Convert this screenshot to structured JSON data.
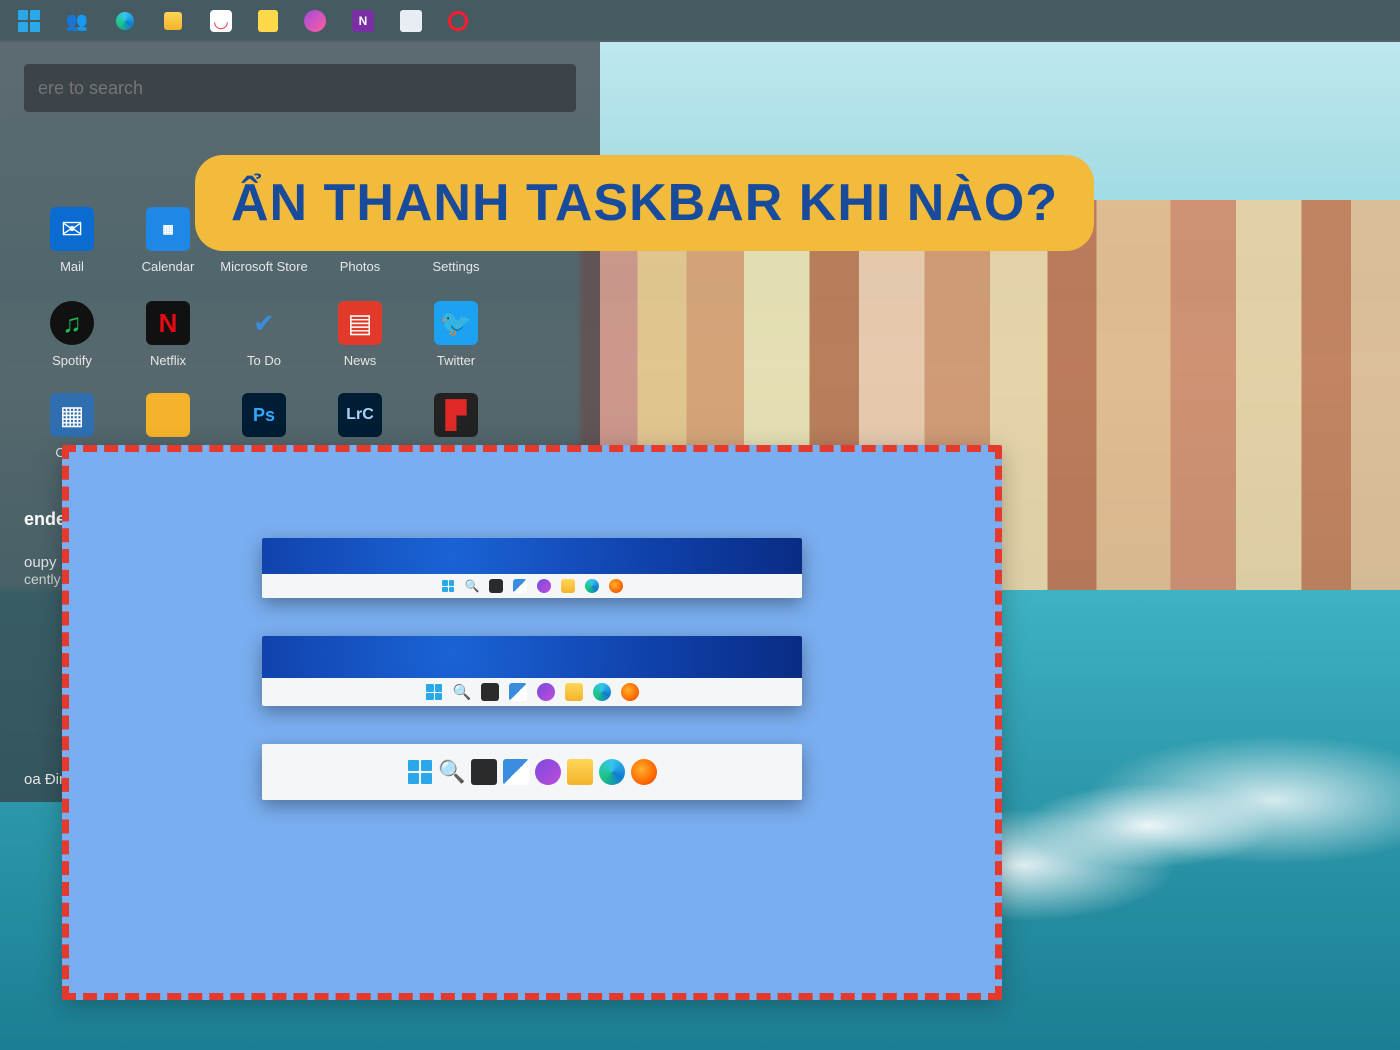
{
  "headline": "ẨN THANH TASKBAR KHI NÀO?",
  "search": {
    "placeholder": "ere to search"
  },
  "top_taskbar": {
    "icons": [
      "start",
      "people",
      "edge",
      "file-explorer",
      "pocket",
      "sticky-notes",
      "messenger",
      "onenote",
      "photos",
      "opera"
    ]
  },
  "tiles": {
    "row1": [
      {
        "label": "Mail",
        "icon": "mail",
        "bg": "#0a6bd1",
        "fg": "#fff"
      },
      {
        "label": "Calendar",
        "icon": "calendar",
        "bg": "#1f87e6",
        "fg": "#fff"
      },
      {
        "label": "Microsoft Store",
        "icon": "ms-store",
        "bg": "#ffffff",
        "fg": "#333"
      },
      {
        "label": "Photos",
        "icon": "photos",
        "bg": "#2f6fb0",
        "fg": "#fff"
      },
      {
        "label": "Settings",
        "icon": "settings",
        "bg": "transparent",
        "fg": "#e6e6e6"
      }
    ],
    "row2": [
      {
        "label": "Spotify",
        "icon": "spotify",
        "bg": "#111",
        "fg": "#1db954"
      },
      {
        "label": "Netflix",
        "icon": "netflix",
        "bg": "#111",
        "fg": "#e50914"
      },
      {
        "label": "To Do",
        "icon": "todo",
        "bg": "transparent",
        "fg": "#3a8dde"
      },
      {
        "label": "News",
        "icon": "news",
        "bg": "#e23a2a",
        "fg": "#fff"
      },
      {
        "label": "Twitter",
        "icon": "twitter",
        "bg": "#1da1f2",
        "fg": "#fff"
      }
    ],
    "row3": [
      {
        "label": "Calcu",
        "icon": "calculator",
        "bg": "#2f6fb0",
        "fg": "#fff"
      },
      {
        "label": "",
        "icon": "folder",
        "bg": "#f4b32a",
        "fg": "#333"
      },
      {
        "label": "",
        "icon": "ps",
        "bg": "#001d34",
        "fg": "#31a8ff",
        "text": "Ps"
      },
      {
        "label": "",
        "icon": "lrc",
        "bg": "#001d34",
        "fg": "#aad3ff",
        "text": "LrC"
      },
      {
        "label": "",
        "icon": "flipboard",
        "bg": "#222",
        "fg": "#e12828"
      }
    ]
  },
  "recommended": {
    "heading": "ended",
    "line1": "oupy",
    "line2": "cently add"
  },
  "user": {
    "name": "oa Đinh"
  },
  "inset": {
    "mini_taskbar_icons": [
      "start",
      "search",
      "task-view",
      "widgets",
      "chat",
      "file-explorer",
      "edge",
      "firefox"
    ]
  }
}
